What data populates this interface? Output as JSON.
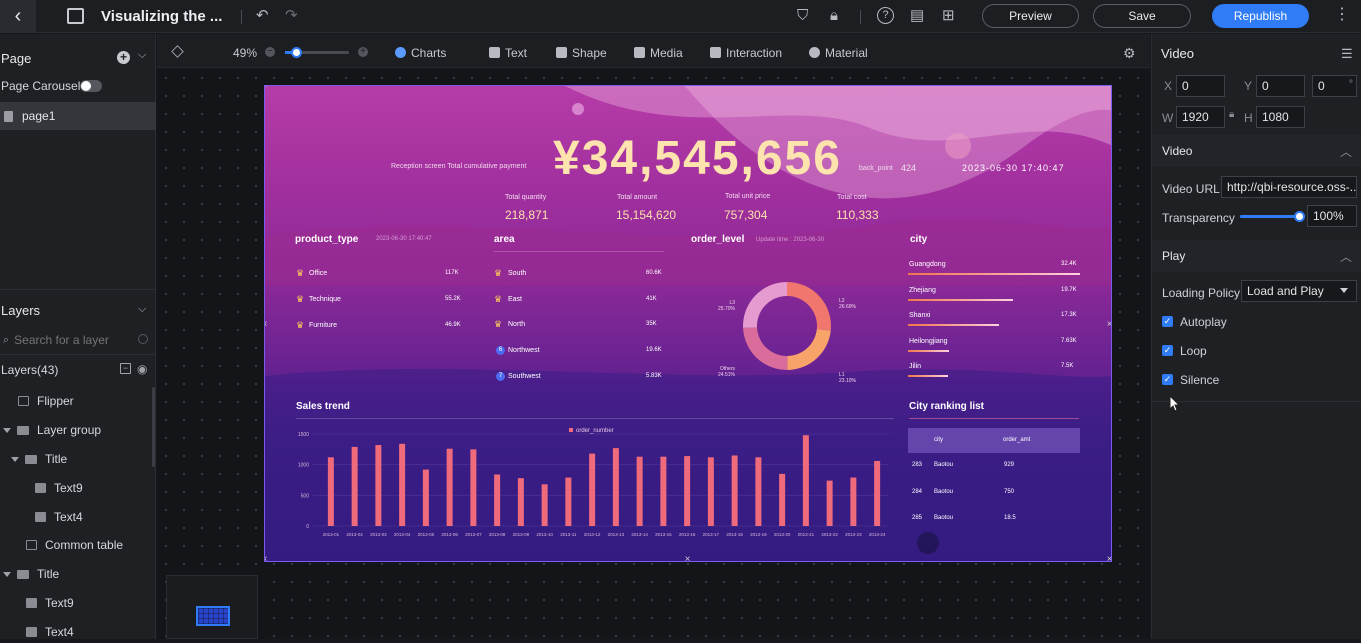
{
  "topbar": {
    "title": "Visualizing the ...",
    "preview_label": "Preview",
    "save_label": "Save",
    "republish_label": "Republish"
  },
  "left_panel": {
    "page_heading": "Page",
    "page_carousel_label": "Page Carousel",
    "pages": [
      "page1"
    ],
    "layers_heading": "Layers",
    "search_placeholder": "Search for a layer",
    "layers_count_label": "Layers(43)",
    "layers": [
      {
        "label": "Flipper"
      },
      {
        "label": "Layer group"
      },
      {
        "label": "Title"
      },
      {
        "label": "Text9"
      },
      {
        "label": "Text4"
      },
      {
        "label": "Common table"
      },
      {
        "label": "Title"
      },
      {
        "label": "Text9"
      },
      {
        "label": "Text4"
      }
    ]
  },
  "toolbar": {
    "zoom": "49%",
    "items": [
      "Charts",
      "Text",
      "Shape",
      "Media",
      "Interaction",
      "Material"
    ]
  },
  "dashboard": {
    "header_caption": "Reception screen  Total cumulative payment",
    "total_payment": "¥34,545,656",
    "back_point_label": "back_point",
    "back_point_value": "424",
    "datetime": "2023-06-30  17:40:47",
    "kpis": [
      {
        "label": "Total quantity",
        "value": "218,871"
      },
      {
        "label": "Total amount",
        "value": "15,154,620"
      },
      {
        "label": "Total unit price",
        "value": "757,304"
      },
      {
        "label": "Total cost",
        "value": "110,333"
      }
    ],
    "product_type": {
      "title": "product_type",
      "timestamp": "2023-06-30 17:40:47",
      "rows": [
        {
          "name": "Office",
          "value": "117K"
        },
        {
          "name": "Technique",
          "value": "55.2K"
        },
        {
          "name": "Furniture",
          "value": "46.9K"
        }
      ]
    },
    "area": {
      "title": "area",
      "rows": [
        {
          "rank": "",
          "name": "South",
          "value": "60.6K"
        },
        {
          "rank": "",
          "name": "East",
          "value": "41K"
        },
        {
          "rank": "",
          "name": "North",
          "value": "35K"
        },
        {
          "rank": "6",
          "name": "Northwest",
          "value": "19.6K"
        },
        {
          "rank": "7",
          "name": "Southwest",
          "value": "5.83K"
        }
      ]
    },
    "order_level": {
      "title": "order_level",
      "update": "Update time : 2023-06-30",
      "slices": [
        {
          "label": "L2",
          "pct": "26.69%",
          "value": 26.69,
          "color": "#f0766e"
        },
        {
          "label": "L1",
          "pct": "23.10%",
          "value": 23.1,
          "color": "#f7a36a"
        },
        {
          "label": "Others",
          "pct": "24.51%",
          "value": 24.51,
          "color": "#d96c9a"
        },
        {
          "label": "L3",
          "pct": "25.70%",
          "value": 25.7,
          "color": "#e59ad0"
        }
      ]
    },
    "city": {
      "title": "city",
      "rows": [
        {
          "name": "Guangdong",
          "value": "32.4K",
          "frac": 1.0
        },
        {
          "name": "Zhejiang",
          "value": "19.7K",
          "frac": 0.61
        },
        {
          "name": "Shanxi",
          "value": "17.3K",
          "frac": 0.53
        },
        {
          "name": "Heilongjiang",
          "value": "7.63K",
          "frac": 0.24
        },
        {
          "name": "Jilin",
          "value": "7.5K",
          "frac": 0.23
        }
      ]
    },
    "sales_trend": {
      "title": "Sales trend",
      "legend": "order_number",
      "yticks": [
        "1500",
        "1000",
        "500",
        "0"
      ]
    },
    "city_ranking": {
      "title": "City ranking list",
      "columns": [
        "city",
        "order_amt"
      ],
      "rows": [
        {
          "rank": "283",
          "city": "Baotou",
          "amt": "929"
        },
        {
          "rank": "284",
          "city": "Baotou",
          "amt": "750"
        },
        {
          "rank": "285",
          "city": "Baotou",
          "amt": "18.5"
        }
      ]
    }
  },
  "chart_data": {
    "type": "bar",
    "title": "Sales trend",
    "categories": [
      "2013-01",
      "2013-02",
      "2013-03",
      "2013-04",
      "2013-05",
      "2013-06",
      "2013-07",
      "2013-08",
      "2013-09",
      "2013-10",
      "2013-11",
      "2013-12",
      "2013-13",
      "2013-14",
      "2013-15",
      "2013-16",
      "2013-17",
      "2013-18",
      "2013-19",
      "2013-20",
      "2013-21",
      "2013-22",
      "2013-23",
      "2013-24"
    ],
    "series": [
      {
        "name": "order_number",
        "values": [
          1120,
          1290,
          1320,
          1340,
          920,
          1260,
          1250,
          840,
          780,
          680,
          790,
          1180,
          1270,
          1130,
          1130,
          1140,
          1120,
          1150,
          1120,
          850,
          1480,
          740,
          790,
          1060
        ]
      }
    ],
    "ylim": [
      0,
      1500
    ],
    "bar_color": "#ef6a7b"
  },
  "right_panel": {
    "title": "Video",
    "x": "0",
    "y": "0",
    "rotation": "0",
    "w": "1920",
    "h": "1080",
    "video_section": "Video",
    "video_url_label": "Video URL",
    "video_url": "http://qbi-resource.oss-...",
    "transparency_label": "Transparency",
    "transparency_value": "100%",
    "transparency_frac": 1.0,
    "play_section": "Play",
    "loading_policy_label": "Loading Policy",
    "loading_policy_value": "Load and Play",
    "autoplay_label": "Autoplay",
    "loop_label": "Loop",
    "silence_label": "Silence"
  }
}
